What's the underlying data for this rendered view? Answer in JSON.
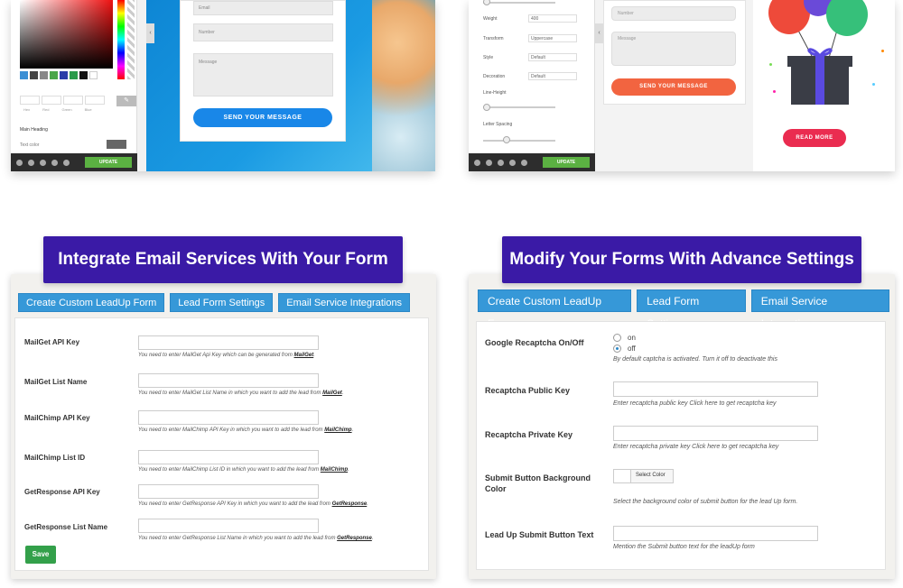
{
  "colors": {
    "accent": "#3698d8",
    "banner": "#3a1aa6",
    "save": "#33a04a",
    "send_blue": "#1987e8",
    "send_orange": "#f26440",
    "read_more": "#ea2c50",
    "update": "#5bb142"
  },
  "preview_left": {
    "fields": [
      "Email",
      "Number",
      "Message"
    ],
    "send_label": "SEND YOUR MESSAGE",
    "main_heading_label": "Main Heading",
    "text_color_label": "Text color",
    "rgba_labels": [
      "Hex",
      "Red",
      "Green",
      "Blue"
    ],
    "update_label": "UPDATE"
  },
  "preview_right": {
    "panel_rows": [
      {
        "label": "Weight",
        "value": "400"
      },
      {
        "label": "Transform",
        "value": "Uppercase"
      },
      {
        "label": "Style",
        "value": "Default"
      },
      {
        "label": "Decoration",
        "value": "Default"
      }
    ],
    "line_height_label": "Line-Height",
    "letter_spacing_label": "Letter Spacing",
    "fields": [
      "Number",
      "Message"
    ],
    "send_label": "SEND YOUR MESSAGE",
    "read_more_label": "READ MORE",
    "update_label": "UPDATE"
  },
  "left": {
    "banner": "Integrate Email Services With Your Form",
    "tabs": [
      "Create Custom LeadUp Form",
      "Lead Form Settings",
      "Email Service Integrations"
    ],
    "rows": [
      {
        "label": "MailGet API Key",
        "hint": "You need to enter MailGet Api Key which can be generated from ",
        "link": "MailGet",
        "end": "."
      },
      {
        "label": "MailGet List Name",
        "hint": "You need to enter MailGet List Name in which you want to add the lead from ",
        "link": "MailGet",
        "end": "."
      },
      {
        "label": "MailChimp API Key",
        "hint": "You need to enter MailChimp API Key in which you want to add the lead from ",
        "link": "MailChimp",
        "end": "."
      },
      {
        "label": "MailChimp List ID",
        "hint": "You need to enter MailChimp List ID in which you want to add the lead from ",
        "link": "MailChimp",
        "end": "."
      },
      {
        "label": "GetResponse API Key",
        "hint": "You need to enter GetResponse API Key in which you want to add the lead from ",
        "link": "GetResponse",
        "end": "."
      },
      {
        "label": "GetResponse List Name",
        "hint": "You need to enter GetResponse List Name in which you want to add the lead from ",
        "link": "GetResponse",
        "end": "."
      }
    ],
    "save_label": "Save"
  },
  "right": {
    "banner": "Modify Your Forms With Advance Settings",
    "tabs": [
      "Create Custom LeadUp Form",
      "Lead Form Settings",
      "Email Service Integrations"
    ],
    "recaptcha_label": "Google Recaptcha On/Off",
    "radio_on": "on",
    "radio_off": "off",
    "radio_selected": "off",
    "recaptcha_hint": "By default captcha is activated. Turn it off to deactivate this",
    "public_key_label": "Recaptcha Public Key",
    "public_key_hint": "Enter recaptcha public key Click here to get recaptcha key",
    "private_key_label": "Recaptcha Private Key",
    "private_key_hint": "Enter recaptcha private key Click here to get recaptcha key",
    "bg_color_label": "Submit Button Background Color",
    "select_color_label": "Select Color",
    "bg_color_hint": "Select the background color of submit button for the lead Up form.",
    "submit_text_label": "Lead Up Submit Button Text",
    "submit_text_hint": "Mention the Submit button text for the leadUp form"
  }
}
